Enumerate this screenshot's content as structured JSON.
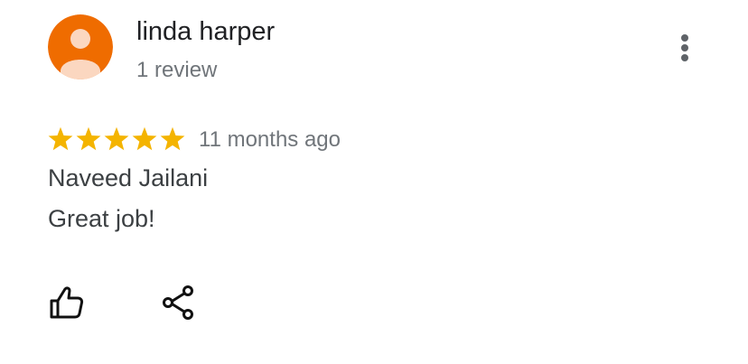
{
  "reviewer": {
    "name": "linda harper",
    "review_count": "1 review",
    "avatar_icon": "person-avatar-icon",
    "avatar_color": "#ef6c00"
  },
  "review": {
    "rating": 5,
    "rating_max": 5,
    "star_color": "#f4b400",
    "time": "11 months ago",
    "lines": [
      "Naveed Jailani",
      "Great job!"
    ]
  },
  "actions": {
    "more_icon": "more-vertical-icon",
    "like_icon": "thumb-up-icon",
    "share_icon": "share-icon"
  }
}
